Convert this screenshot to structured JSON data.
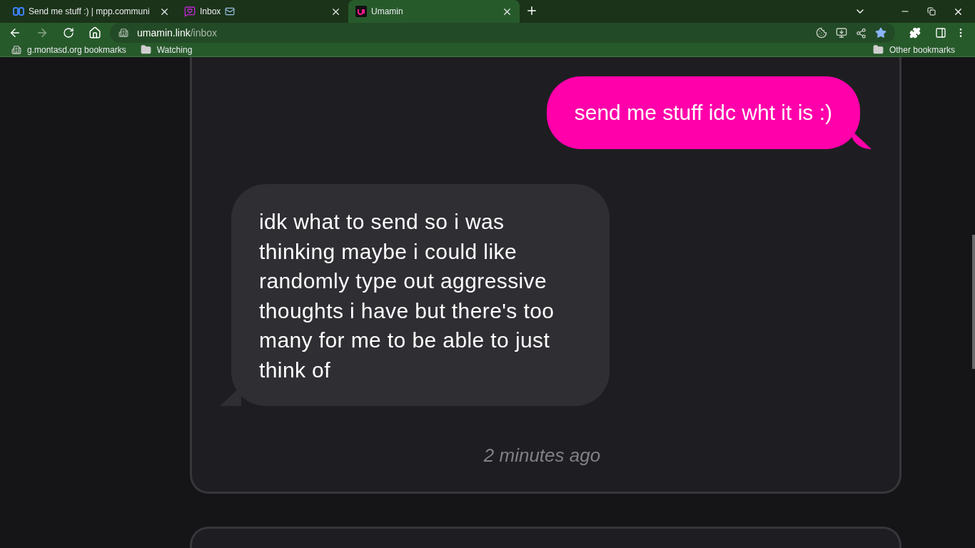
{
  "tabs": [
    {
      "title": "Send me stuff :) | mpp.communi",
      "selected": false
    },
    {
      "title": "Inbox",
      "selected": false
    },
    {
      "title": "Umamin",
      "selected": true
    }
  ],
  "address_bar": {
    "domain": "umamin.link",
    "path": "/inbox",
    "bookmarked": true
  },
  "bookmarks": [
    "g.montasd.org bookmarks",
    "Watching"
  ],
  "other_bookmarks": "Other bookmarks",
  "message": {
    "question": "send me stuff idc wht it is :)",
    "reply": "idk what to send so i was thinking maybe i could like randomly type out aggressive thoughts i have but there's too many for me to be able to just think of",
    "time": "2 minutes ago"
  }
}
